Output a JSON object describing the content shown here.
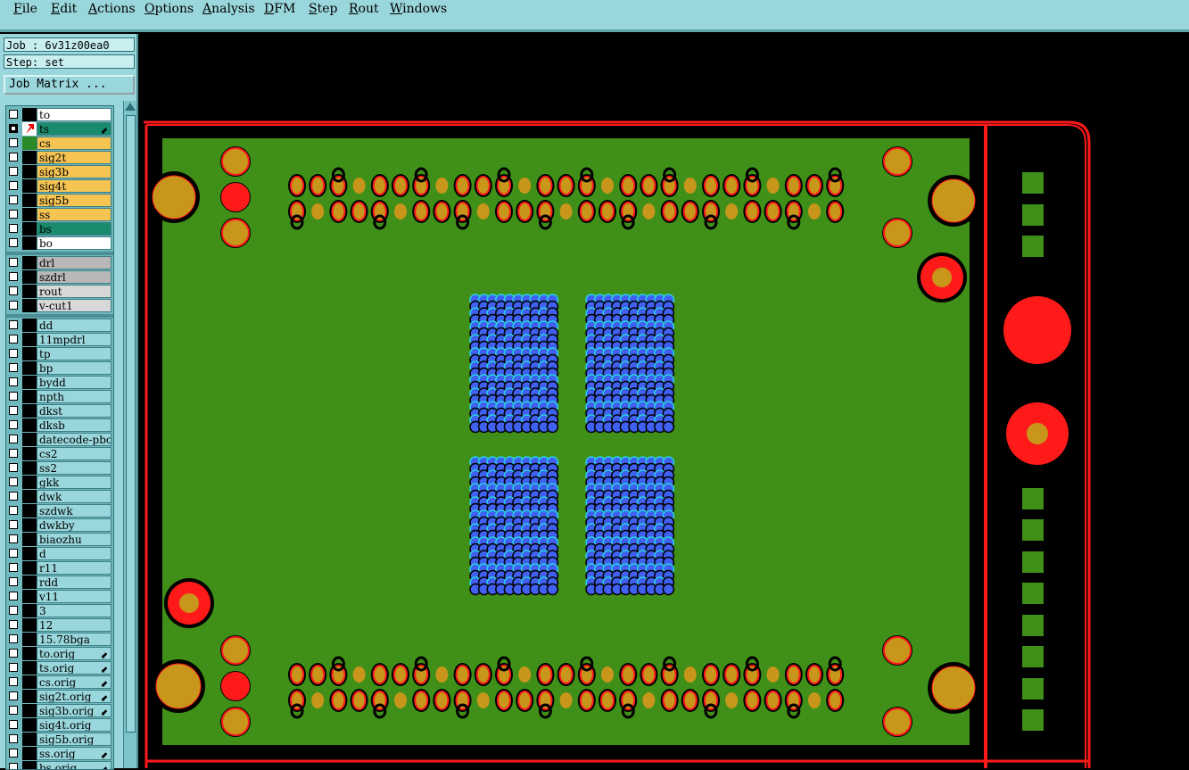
{
  "menu": [
    "File",
    "Edit",
    "Actions",
    "Options",
    "Analysis",
    "DFM",
    "Step",
    "Rout",
    "Windows"
  ],
  "job_label": "Job : 6v31z00ea0",
  "step_label": "Step: set",
  "job_matrix_button": "Job Matrix ...",
  "layers_group1": [
    {
      "name": "to",
      "bg": "#ffffff",
      "cb": "off",
      "sw": "#000000"
    },
    {
      "name": "ts",
      "bg": "#1a8c6e",
      "cb": "on",
      "sw": "#000000",
      "arrow": true
    },
    {
      "name": "cs",
      "bg": "#f6c453",
      "cb": "off",
      "sw": "#2a8a2a"
    },
    {
      "name": "sig2t",
      "bg": "#f6c453",
      "cb": "off",
      "sw": "#000000"
    },
    {
      "name": "sig3b",
      "bg": "#f6c453",
      "cb": "off",
      "sw": "#000000"
    },
    {
      "name": "sig4t",
      "bg": "#f6c453",
      "cb": "off",
      "sw": "#000000"
    },
    {
      "name": "sig5b",
      "bg": "#f6c453",
      "cb": "off",
      "sw": "#000000"
    },
    {
      "name": "ss",
      "bg": "#f6c453",
      "cb": "off",
      "sw": "#000000"
    },
    {
      "name": "bs",
      "bg": "#1a8c6e",
      "cb": "off",
      "sw": "#000000"
    },
    {
      "name": "bo",
      "bg": "#ffffff",
      "cb": "off",
      "sw": "#000000"
    }
  ],
  "layers_group2": [
    {
      "name": "drl",
      "bg": "#b8b8b8",
      "cb": "off",
      "sw": "#000000"
    },
    {
      "name": "szdrl",
      "bg": "#b8b8b8",
      "cb": "off",
      "sw": "#000000"
    },
    {
      "name": "rout",
      "bg": "#d8d8d8",
      "cb": "off",
      "sw": "#000000"
    },
    {
      "name": "v-cut1",
      "bg": "#d8d8d8",
      "cb": "off",
      "sw": "#000000"
    }
  ],
  "layers_group3": [
    {
      "name": "dd"
    },
    {
      "name": "11mpdrl"
    },
    {
      "name": "tp"
    },
    {
      "name": "bp"
    },
    {
      "name": "bydd"
    },
    {
      "name": "npth"
    },
    {
      "name": "dkst"
    },
    {
      "name": "dksb"
    },
    {
      "name": "datecode-pbo"
    },
    {
      "name": "cs2"
    },
    {
      "name": "ss2"
    },
    {
      "name": "gkk"
    },
    {
      "name": "dwk"
    },
    {
      "name": "szdwk"
    },
    {
      "name": "dwkby"
    },
    {
      "name": "biaozhu"
    },
    {
      "name": "d"
    },
    {
      "name": "r11"
    },
    {
      "name": "rdd"
    },
    {
      "name": "v11"
    },
    {
      "name": "3"
    },
    {
      "name": "12"
    },
    {
      "name": "15.78bga"
    },
    {
      "name": "to.orig",
      "arrow": true
    },
    {
      "name": "ts.orig",
      "arrow": true
    },
    {
      "name": "cs.orig",
      "arrow": true
    },
    {
      "name": "sig2t.orig",
      "arrow": true
    },
    {
      "name": "sig3b.orig",
      "arrow": true
    },
    {
      "name": "sig4t.orig"
    },
    {
      "name": "sig5b.orig"
    },
    {
      "name": "ss.orig",
      "arrow": true
    },
    {
      "name": "bs.orig",
      "arrow": true
    }
  ],
  "colors": {
    "board_green": "#3f8f18",
    "outline_red": "#ff1a1a",
    "pad_gold": "#c8961a",
    "bga_blue": "#4060f0",
    "bga_cyan": "#2ad0e0",
    "tab_green": "#3f8f18"
  }
}
